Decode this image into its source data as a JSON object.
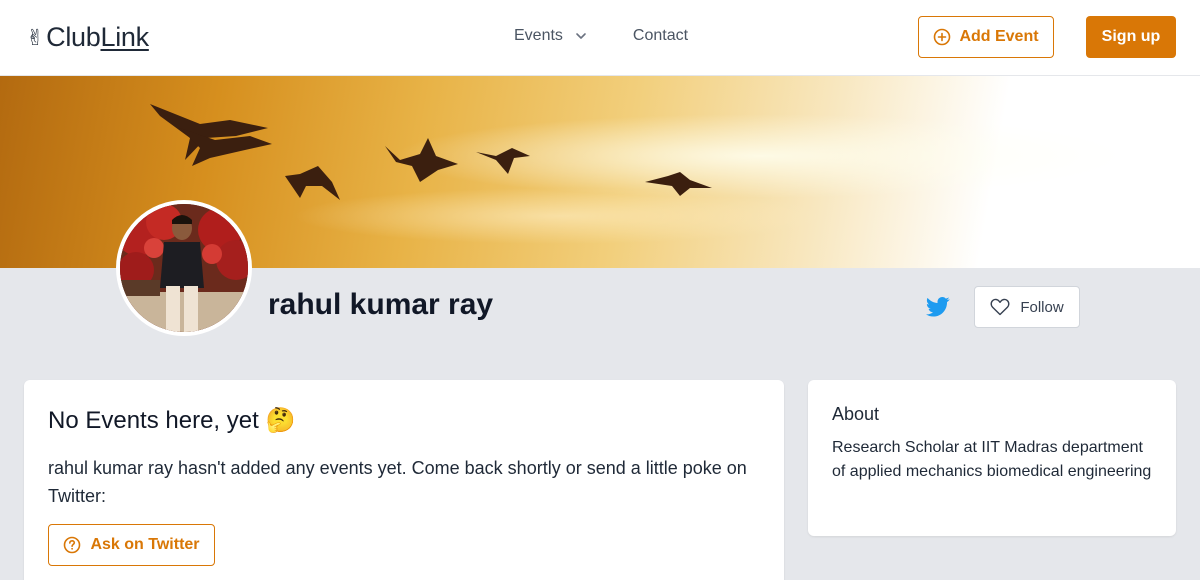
{
  "brand": {
    "name_part1": "Club",
    "name_part2": "Link",
    "logo_glyph": "✌"
  },
  "nav": {
    "events_label": "Events",
    "contact_label": "Contact"
  },
  "header_actions": {
    "add_event_label": "Add Event",
    "signup_label": "Sign up"
  },
  "profile": {
    "name": "rahul kumar ray",
    "follow_label": "Follow"
  },
  "events_card": {
    "title": "No Events here, yet 🤔",
    "description": "rahul kumar ray hasn't added any events yet. Come back shortly or send a little poke on Twitter:",
    "ask_button_label": "Ask on Twitter"
  },
  "about_card": {
    "title": "About",
    "text": "Research Scholar at IIT Madras department of applied mechanics biomedical engineering"
  },
  "colors": {
    "accent": "#d97706",
    "page_bg": "#e5e7eb",
    "twitter": "#1d9bf0"
  },
  "icons": [
    "chevron-down-icon",
    "plus-circle-icon",
    "twitter-icon",
    "heart-icon",
    "question-circle-icon"
  ]
}
